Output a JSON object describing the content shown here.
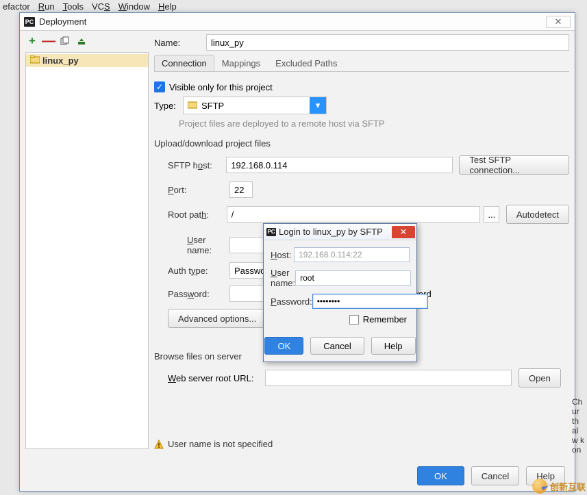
{
  "menu": {
    "items": [
      "efactor",
      "Run",
      "Tools",
      "VCS",
      "Window",
      "Help"
    ],
    "underline": [
      null,
      0,
      0,
      2,
      0,
      0
    ]
  },
  "dialog": {
    "title": "Deployment",
    "toolbar": {
      "add": "+",
      "remove": "—",
      "copy": "⧉",
      "deploy": "⬆"
    },
    "list": {
      "selected": "linux_py"
    },
    "name_label": "Name:",
    "name_value": "linux_py",
    "tabs": [
      "Connection",
      "Mappings",
      "Excluded Paths"
    ],
    "visible_label": "Visible only for this project",
    "type_label": "Type:",
    "type_value": "SFTP",
    "type_hint": "Project files are deployed to a remote host via SFTP",
    "section1": "Upload/download project files",
    "fields": {
      "sftp_host_label": "SFTP host:",
      "sftp_host": "192.168.0.114",
      "test_btn": "Test SFTP connection...",
      "port_label": "Port:",
      "port": "22",
      "root_label": "Root path:",
      "root": "/",
      "root_more": "...",
      "autodetect": "Autodetect",
      "user_label": "User name:",
      "user": "",
      "auth_label": "Auth type:",
      "auth": "Passwo",
      "pwd_label": "Password:",
      "pwd": "",
      "save_pwd_tail": "sword",
      "advanced": "Advanced options..."
    },
    "section2": "Browse files on server",
    "web": {
      "label": "Web server root URL:",
      "value": "",
      "open": "Open"
    },
    "warning": "User name is not specified",
    "footer": {
      "ok": "OK",
      "cancel": "Cancel",
      "help": "Help"
    }
  },
  "login": {
    "title": "Login to linux_py by SFTP",
    "host_label": "Host:",
    "host": "192.168.0.114:22",
    "user_label": "User name:",
    "user": "root",
    "pwd_label": "Password:",
    "pwd": "••••••••",
    "remember": "Remember",
    "ok": "OK",
    "cancel": "Cancel",
    "help": "Help"
  },
  "side_clip": "Ch\nur\nth\nal\nw k\non",
  "watermark": "创新互联"
}
